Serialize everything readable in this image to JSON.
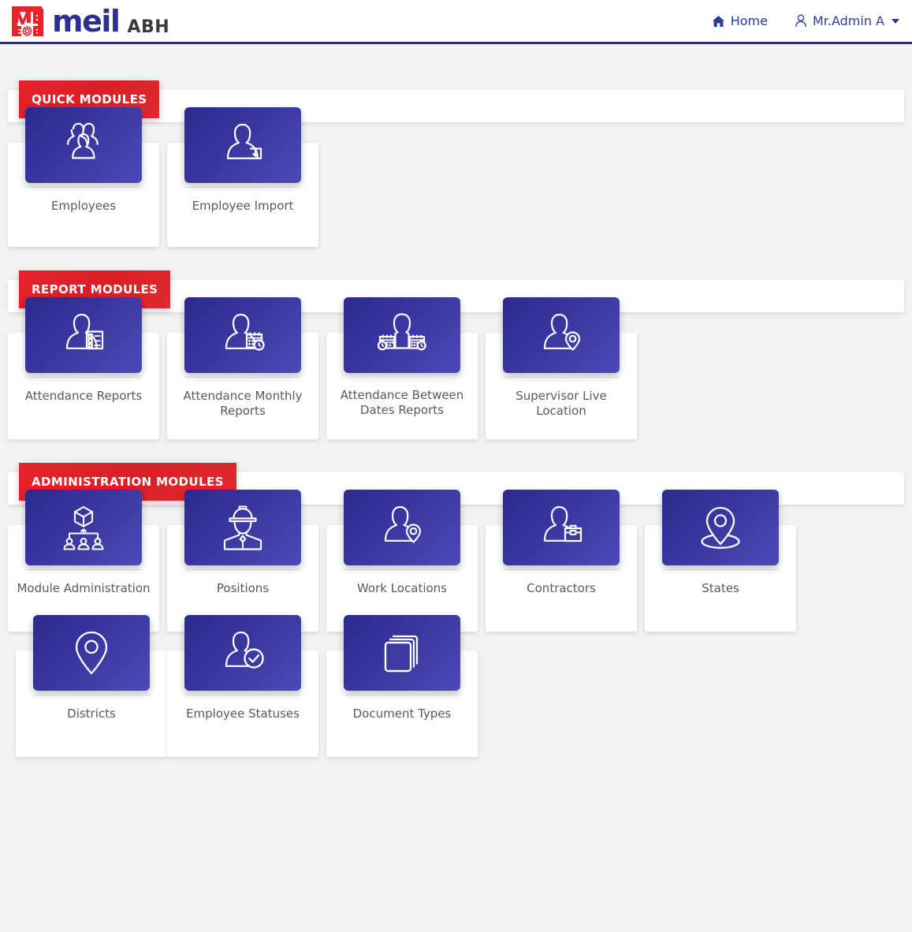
{
  "header": {
    "brand_name": "meil",
    "brand_suffix": "ABH",
    "brand_color": "#2b2f8f",
    "logo_color": "#e8232a",
    "nav": {
      "home_label": "Home",
      "home_icon": "home-icon",
      "user_label": "Mr.Admin A",
      "user_icon": "user-icon",
      "caret_icon": "chevron-down-icon"
    }
  },
  "theme": {
    "badge_red": "#d81f26",
    "tile_blue_dark": "#2b2a8e",
    "tile_blue_light": "#4c4ab8",
    "page_background": "#f2f2f2",
    "label_color": "#5a5a5a"
  },
  "sections": [
    {
      "id": "quick-modules",
      "title": "QUICK MODULES",
      "tiles": [
        {
          "label": "Employees",
          "icon": "users-group-icon",
          "lines": 1
        },
        {
          "label": "Employee Import",
          "icon": "user-download-icon",
          "lines": 1
        }
      ]
    },
    {
      "id": "report-modules",
      "title": "REPORT MODULES",
      "tiles": [
        {
          "label": "Attendance Reports",
          "icon": "user-checklist-icon",
          "lines": 1
        },
        {
          "label": "Attendance Monthly Reports",
          "icon": "user-calendar-clock-icon",
          "lines": 2
        },
        {
          "label": "Attendance Between Dates Reports",
          "icon": "user-two-calendars-icon",
          "lines": 3
        },
        {
          "label": "Supervisor Live Location",
          "icon": "user-location-pin-icon",
          "lines": 2
        }
      ]
    },
    {
      "id": "administration-modules",
      "title": "ADMINISTRATION MODULES",
      "tiles": [
        {
          "label": "Module Administration",
          "icon": "cube-org-chart-icon",
          "lines": 2
        },
        {
          "label": "Positions",
          "icon": "hardhat-worker-icon",
          "lines": 1
        },
        {
          "label": "Work Locations",
          "icon": "user-location-pin-icon",
          "lines": 1
        },
        {
          "label": "Contractors",
          "icon": "user-briefcase-icon",
          "lines": 1
        },
        {
          "label": "States",
          "icon": "map-pin-base-icon",
          "lines": 1
        },
        {
          "label": "Districts",
          "icon": "map-pin-icon",
          "lines": 1
        },
        {
          "label": "Employee Statuses",
          "icon": "user-check-icon",
          "lines": 1
        },
        {
          "label": "Document Types",
          "icon": "documents-stack-icon",
          "lines": 1
        }
      ]
    }
  ]
}
